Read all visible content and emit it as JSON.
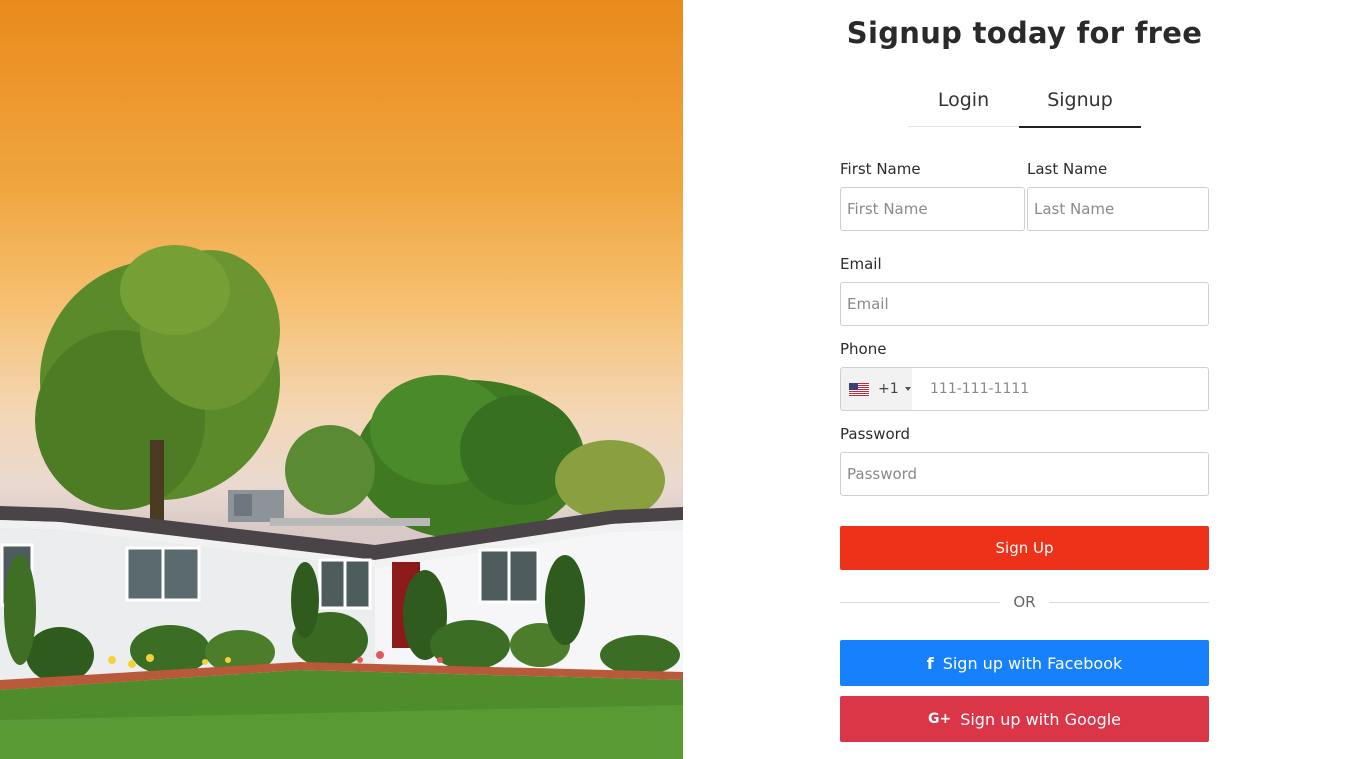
{
  "hero_image": {
    "alt": ""
  },
  "signup": {
    "title": "Signup today for free",
    "tabs": [
      {
        "label": "Login",
        "active": false
      },
      {
        "label": "Signup",
        "active": true
      }
    ],
    "first_name": {
      "label": "First Name",
      "placeholder": "First Name",
      "value": ""
    },
    "last_name": {
      "label": "Last Name",
      "placeholder": "Last Name",
      "value": ""
    },
    "email": {
      "label": "Email",
      "placeholder": "Email",
      "value": ""
    },
    "phone": {
      "label": "Phone",
      "country_flag": "us-flag-icon",
      "dial_code": "+1",
      "placeholder": "111-111-1111",
      "value": ""
    },
    "password": {
      "label": "Password",
      "placeholder": "Password",
      "value": ""
    },
    "submit_label": "Sign Up",
    "divider_text": "OR",
    "facebook_label": "Sign up with Facebook",
    "google_label": "Sign up with Google"
  },
  "colors": {
    "primary": "#ee3219",
    "facebook": "#1781fd",
    "google": "#db3548"
  }
}
